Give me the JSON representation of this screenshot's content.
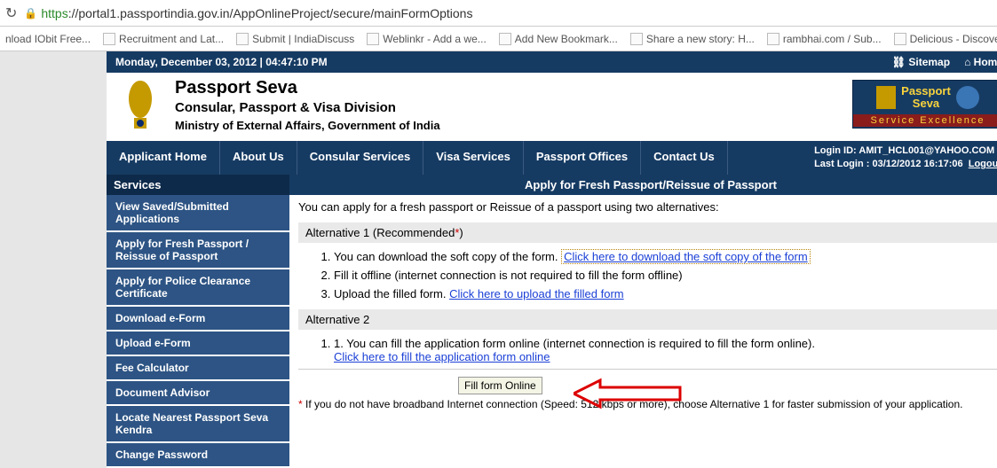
{
  "browser": {
    "url_https": "https",
    "url_rest": "://portal1.passportindia.gov.in/AppOnlineProject/secure/mainFormOptions"
  },
  "bookmarks": [
    "nload IObit Free...",
    "Recruitment and Lat...",
    "Submit | IndiaDiscuss",
    "Weblinkr - Add a we...",
    "Add New Bookmark...",
    "Share a new story: H...",
    "rambhai.com / Sub...",
    "Delicious - Discover"
  ],
  "topbar": {
    "datetime": "Monday,  December  03, 2012 | 04:47:10 PM",
    "sitemap": "Sitemap",
    "home": "Home"
  },
  "header": {
    "title": "Passport Seva",
    "subtitle": "Consular, Passport & Visa Division",
    "ministry": "Ministry of External Affairs, Government of India",
    "badge_line1a": "Passport",
    "badge_line1b": "Seva",
    "badge_line2": "Service Excellence"
  },
  "nav": {
    "items": [
      "Applicant Home",
      "About Us",
      "Consular Services",
      "Visa Services",
      "Passport Offices",
      "Contact Us"
    ],
    "login_id_label": "Login ID: ",
    "login_id": "AMIT_HCL001@YAHOO.COM",
    "last_login_label": "Last Login : ",
    "last_login": "03/12/2012 16:17:06",
    "logout": "Logout"
  },
  "sidebar": {
    "header": "Services",
    "items": [
      "View Saved/Submitted Applications",
      "Apply for Fresh Passport / Reissue of Passport",
      "Apply for Police Clearance Certificate",
      "Download e-Form",
      "Upload e-Form",
      "Fee Calculator",
      "Document Advisor",
      "Locate Nearest Passport Seva Kendra",
      "Change Password"
    ]
  },
  "main": {
    "title": "Apply for Fresh Passport/Reissue of Passport",
    "intro": "You can apply for a fresh passport or Reissue of a passport using two alternatives:",
    "alt1": {
      "header_pre": "Alternative 1 (Recommended",
      "header_post": ")",
      "step1_pre": "You can download the soft copy of the form. ",
      "step1_link": "Click here to download the soft copy of the form",
      "step2": "Fill it offline (internet connection is not required to fill the form offline)",
      "step3_pre": "Upload the filled form. ",
      "step3_link": "Click here to upload the filled form"
    },
    "alt2": {
      "header": "Alternative 2",
      "step1_pre": "1. You can fill the application form online (internet connection is required to fill the form online).",
      "step1_link": "Click here to fill the application form online"
    },
    "tooltip": "Fill form Online",
    "disclaimer": " If you do not have broadband Internet connection (Speed: 512 kbps or more), choose Alternative 1 for faster submission of your application."
  }
}
